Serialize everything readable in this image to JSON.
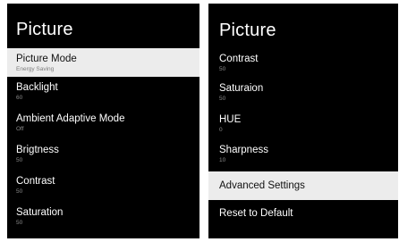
{
  "left_panel": {
    "title": "Picture",
    "items": [
      {
        "label": "Picture Mode",
        "value": "Energy Saving"
      },
      {
        "label": "Backlight",
        "value": "60"
      },
      {
        "label": "Ambient Adaptive Mode",
        "value": "Off"
      },
      {
        "label": "Brigtness",
        "value": "50"
      },
      {
        "label": "Contrast",
        "value": "50"
      },
      {
        "label": "Saturation",
        "value": "50"
      }
    ]
  },
  "right_panel": {
    "title": "Picture",
    "items": [
      {
        "label": "Contrast",
        "value": "50"
      },
      {
        "label": "Saturaion",
        "value": "50"
      },
      {
        "label": "HUE",
        "value": "0"
      },
      {
        "label": "Sharpness",
        "value": "10"
      },
      {
        "label": "Advanced Settings"
      },
      {
        "label": "Reset to Default"
      }
    ]
  }
}
